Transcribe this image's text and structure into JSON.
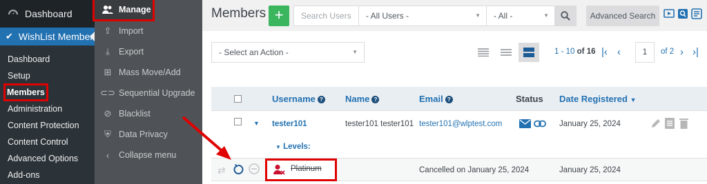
{
  "wp_sidebar": {
    "dashboard_label": "Dashboard",
    "active_plugin_label": "WishList Member",
    "submenu": [
      "Dashboard",
      "Setup",
      "Members",
      "Administration",
      "Content Protection",
      "Content Control",
      "Advanced Options",
      "Add-ons"
    ]
  },
  "wlm_sidebar": {
    "items": [
      {
        "label": "Manage",
        "icon": "users-icon"
      },
      {
        "label": "Import",
        "icon": "import-icon"
      },
      {
        "label": "Export",
        "icon": "export-icon"
      },
      {
        "label": "Mass Move/Add",
        "icon": "mass-move-icon"
      },
      {
        "label": "Sequential Upgrade",
        "icon": "link-icon"
      },
      {
        "label": "Blacklist",
        "icon": "block-icon"
      },
      {
        "label": "Data Privacy",
        "icon": "shield-icon"
      },
      {
        "label": "Collapse menu",
        "icon": "chevron-left-icon"
      }
    ]
  },
  "header": {
    "title": "Members",
    "add_label": "+",
    "search_placeholder": "Search Users",
    "filter_users": "- All Users -",
    "filter_all": "- All -",
    "advanced_search": "Advanced Search"
  },
  "toolbar": {
    "action_select": "- Select an Action -",
    "range": "1 - 10",
    "of_label": "of",
    "total": "16",
    "page_value": "1",
    "pages_label": "of 2"
  },
  "table": {
    "headers": {
      "username": "Username",
      "name": "Name",
      "email": "Email",
      "status": "Status",
      "date": "Date Registered"
    },
    "rows": [
      {
        "username": "tester101",
        "name": "tester101 tester101",
        "email": "tester101@wlptest.com",
        "date": "January 25, 2024"
      }
    ],
    "levels_label": "Levels:",
    "level_row": {
      "level": "Platinum",
      "status": "Cancelled on January 25, 2024",
      "date": "January 25, 2024"
    }
  },
  "colors": {
    "accent": "#2271b1",
    "highlight": "#e00000",
    "add_green": "#3bb55e",
    "wp_active": "#2271b1"
  }
}
